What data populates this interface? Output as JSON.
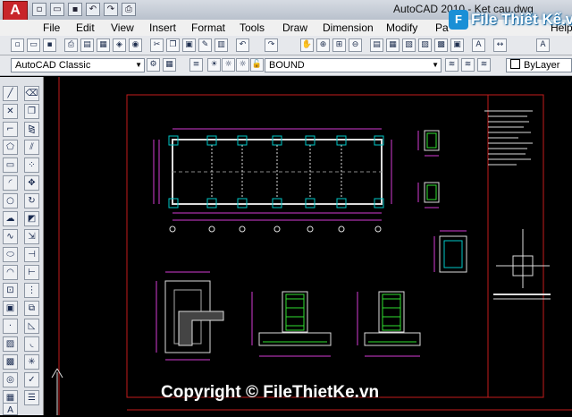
{
  "window": {
    "app_logo": "A",
    "title": "AutoCAD 2010  -  Ket cau.dwg"
  },
  "brand": {
    "icon": "F",
    "text": "File Thiết Kế.vn"
  },
  "quick_access": [
    "new-icon",
    "open-icon",
    "save-icon",
    "undo-icon",
    "redo-icon",
    "print-icon"
  ],
  "menu": [
    "File",
    "Edit",
    "View",
    "Insert",
    "Format",
    "Tools",
    "Draw",
    "Dimension",
    "Modify",
    "Pa",
    "Help"
  ],
  "workspace": {
    "value": "AutoCAD Classic"
  },
  "layer": {
    "value": "BOUND"
  },
  "linetype": {
    "value": "ByLayer"
  },
  "watermark": "Copyright © FileThietKe.vn",
  "colors": {
    "red_border": "#c41d1d",
    "drawing_white": "#ffffff",
    "magenta_dims": "#d43bd4",
    "cyan": "#00d0d0",
    "green_rebar": "#30e030"
  }
}
